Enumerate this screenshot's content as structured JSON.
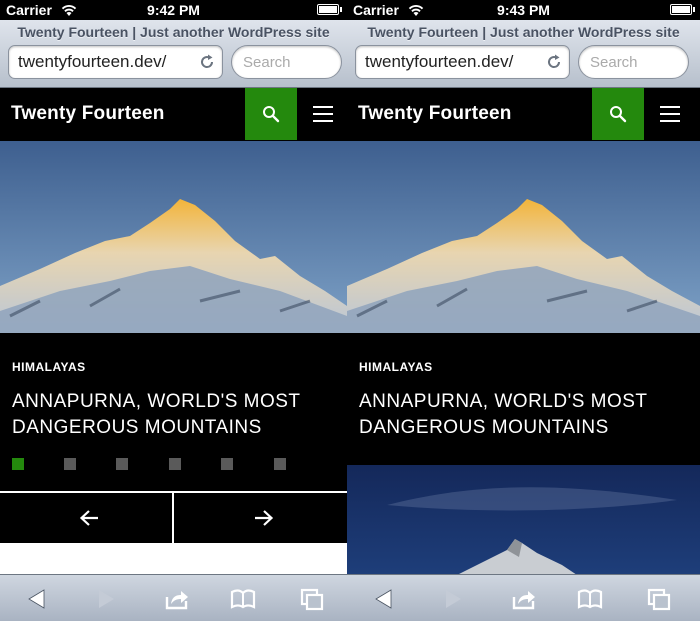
{
  "left": {
    "status": {
      "carrier": "Carrier",
      "time": "9:42 PM"
    },
    "browser": {
      "page_title": "Twenty Fourteen | Just another WordPress site",
      "url": "twentyfourteen.dev/",
      "search_placeholder": "Search"
    },
    "site": {
      "title": "Twenty Fourteen"
    },
    "post": {
      "category": "HIMALAYAS",
      "title": "ANNAPURNA, WORLD'S MOST DANGEROUS MOUNTAINS"
    },
    "slider": {
      "dots": 6,
      "active_index": 0
    }
  },
  "right": {
    "status": {
      "carrier": "Carrier",
      "time": "9:43 PM"
    },
    "browser": {
      "page_title": "Twenty Fourteen | Just another WordPress site",
      "url": "twentyfourteen.dev/",
      "search_placeholder": "Search"
    },
    "site": {
      "title": "Twenty Fourteen"
    },
    "post": {
      "category": "HIMALAYAS",
      "title": "ANNAPURNA, WORLD'S MOST DANGEROUS MOUNTAINS"
    }
  },
  "colors": {
    "accent": "#24890d",
    "dot_inactive": "#5a5a5a",
    "header_bg": "#000000"
  },
  "icons": {
    "search": "search-icon",
    "menu": "hamburger-menu-icon",
    "prev": "arrow-left-icon",
    "next": "arrow-right-icon",
    "back": "back-triangle-icon",
    "forward": "forward-triangle-icon",
    "share": "share-icon",
    "bookmarks": "bookmarks-book-icon",
    "tabs": "tabs-pages-icon"
  }
}
